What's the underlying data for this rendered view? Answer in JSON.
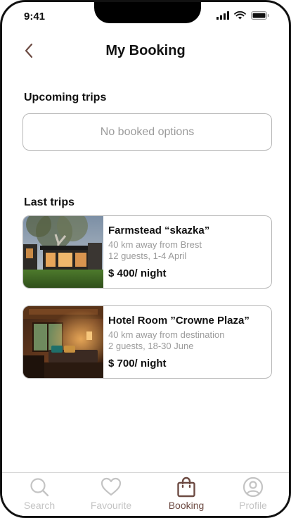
{
  "status_bar": {
    "time": "9:41"
  },
  "header": {
    "title": "My Booking"
  },
  "upcoming": {
    "title": "Upcoming trips",
    "empty_text": "No booked options"
  },
  "last": {
    "title": "Last trips",
    "trips": [
      {
        "name": "Farmstead “skazka”",
        "distance": "40 km away from Brest",
        "guests": "12 guests, 1-4 April",
        "price": "$ 400/ night"
      },
      {
        "name": "Hotel Room ”Crowne Plaza”",
        "distance": "40 km away from destination",
        "guests": "2 guests, 18-30 June",
        "price": "$ 700/ night"
      }
    ]
  },
  "tabbar": {
    "items": [
      {
        "label": "Search",
        "icon": "search-icon"
      },
      {
        "label": "Favourite",
        "icon": "heart-icon"
      },
      {
        "label": "Booking",
        "icon": "bag-icon"
      },
      {
        "label": "Profile",
        "icon": "user-icon"
      }
    ],
    "active": "Booking"
  },
  "colors": {
    "accent": "#6d4b43",
    "inactive": "#c4c4c4",
    "muted_text": "#9b9b9b",
    "border": "#b8b8b8"
  }
}
